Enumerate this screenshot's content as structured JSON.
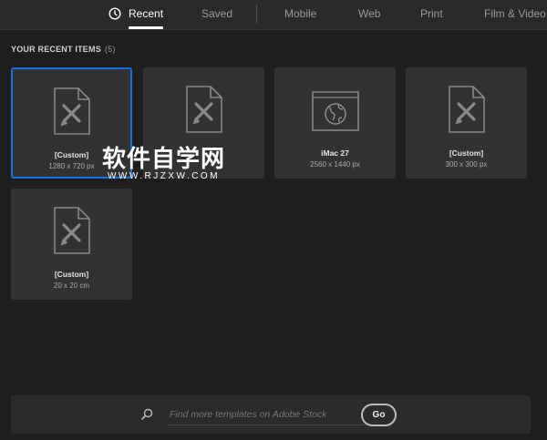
{
  "tabs": [
    {
      "label": "Recent",
      "active": true,
      "icon": "clock-icon"
    },
    {
      "label": "Saved"
    },
    {
      "label": "Mobile"
    },
    {
      "label": "Web"
    },
    {
      "label": "Print"
    },
    {
      "label": "Film & Video"
    }
  ],
  "section": {
    "title": "YOUR RECENT ITEMS",
    "count": "(5)"
  },
  "items": [
    {
      "name": "[Custom]",
      "size": "1280 x 720 px",
      "icon": "document-icon",
      "selected": true
    },
    {
      "name": "",
      "size": "",
      "icon": "document-icon"
    },
    {
      "name": "iMac 27",
      "size": "2560 x 1440 px",
      "icon": "web-icon"
    },
    {
      "name": "[Custom]",
      "size": "300 x 300 px",
      "icon": "document-icon"
    },
    {
      "name": "[Custom]",
      "size": "20 x 20 cm",
      "icon": "document-icon"
    }
  ],
  "search": {
    "placeholder": "Find more templates on Adobe Stock",
    "go_label": "Go"
  },
  "watermark": {
    "cn": "软件自学网",
    "en": "WWW.RJZXW.COM"
  },
  "colors": {
    "accent": "#1473e6"
  }
}
